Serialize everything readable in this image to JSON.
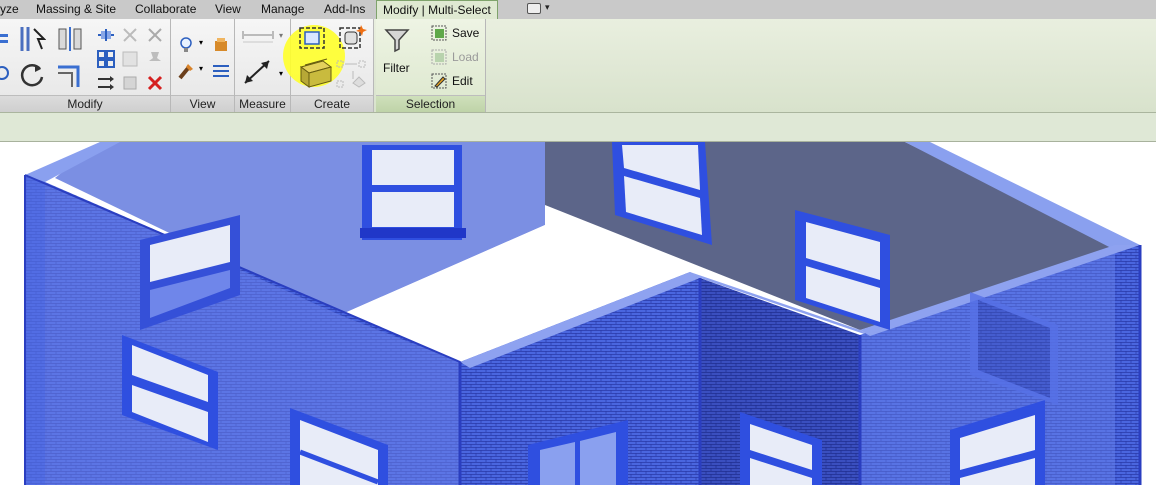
{
  "tabs": [
    {
      "label": "yze"
    },
    {
      "label": "Massing & Site"
    },
    {
      "label": "Collaborate"
    },
    {
      "label": "View"
    },
    {
      "label": "Manage"
    },
    {
      "label": "Add-Ins"
    },
    {
      "label": "Modify | Multi-Select"
    }
  ],
  "panels": {
    "modify": {
      "label": "Modify"
    },
    "view": {
      "label": "View"
    },
    "measure": {
      "label": "Measure"
    },
    "create": {
      "label": "Create"
    },
    "selection": {
      "label": "Selection"
    }
  },
  "selection": {
    "filter_label": "Filter",
    "save_label": "Save",
    "load_label": "Load",
    "edit_label": "Edit"
  },
  "colors": {
    "wall_blue": "#2f4fe0",
    "highlight": "#ffff2a",
    "active_tab": "#dfe9d2"
  }
}
